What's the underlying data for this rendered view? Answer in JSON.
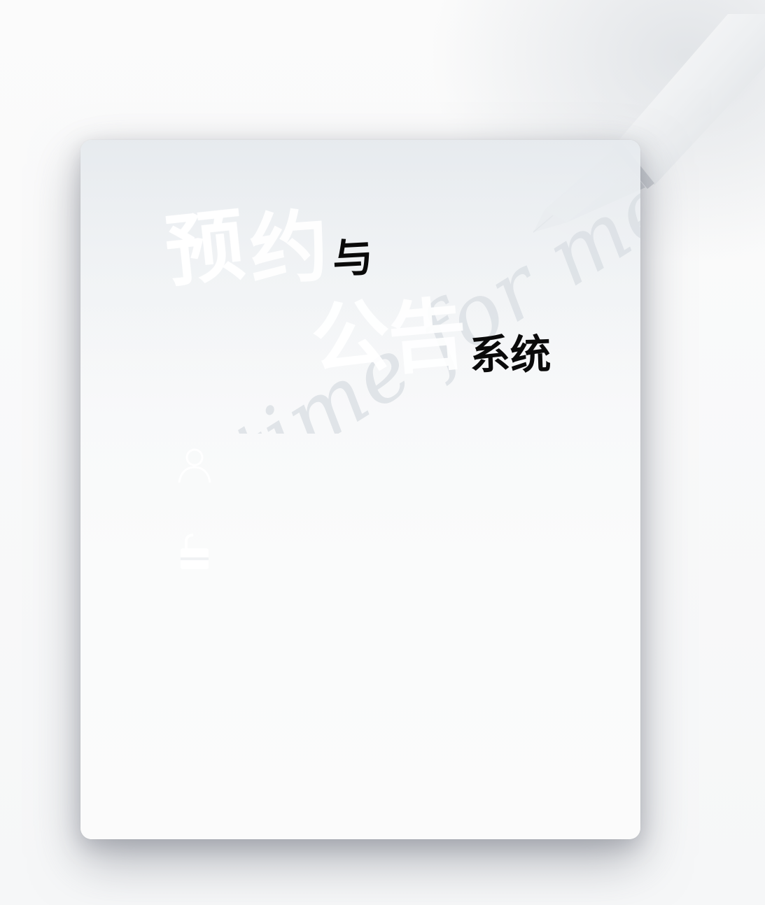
{
  "title": {
    "chars": [
      "预",
      "约",
      "与",
      "公",
      "告",
      "系",
      "统"
    ]
  },
  "decoration": {
    "script_text": "time for me"
  },
  "form": {
    "username": {
      "icon": "user-icon",
      "placeholder": "",
      "value": ""
    },
    "password": {
      "icon": "lock-icon",
      "placeholder": "",
      "value": ""
    }
  },
  "colors": {
    "background": "#f7f7f8",
    "card": "#fafbfb",
    "title_dark": "#0a0a0a",
    "title_light": "#ffffff"
  }
}
